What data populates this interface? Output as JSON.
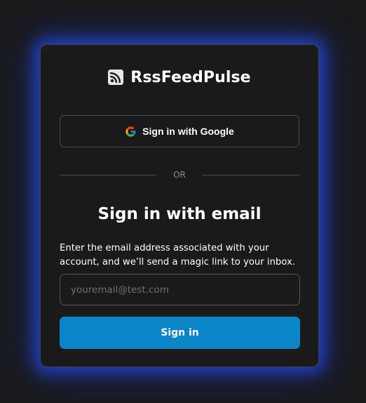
{
  "brand": {
    "name": "RssFeedPulse",
    "icon": "rss-feed-icon"
  },
  "google": {
    "label": "Sign in with Google",
    "icon": "google-icon"
  },
  "divider": {
    "text": "OR"
  },
  "email_section": {
    "heading": "Sign in with email",
    "description": "Enter the email address associated with your account, and we’ll send a magic link to your inbox.",
    "input_placeholder": "youremail@test.com",
    "input_value": "",
    "submit_label": "Sign in"
  },
  "colors": {
    "background": "#1a1a1b",
    "card_border": "#404047",
    "glow": "#2546d2",
    "primary_button": "#0a85c8",
    "text": "#ffffff",
    "muted_text": "#8a8a92"
  }
}
